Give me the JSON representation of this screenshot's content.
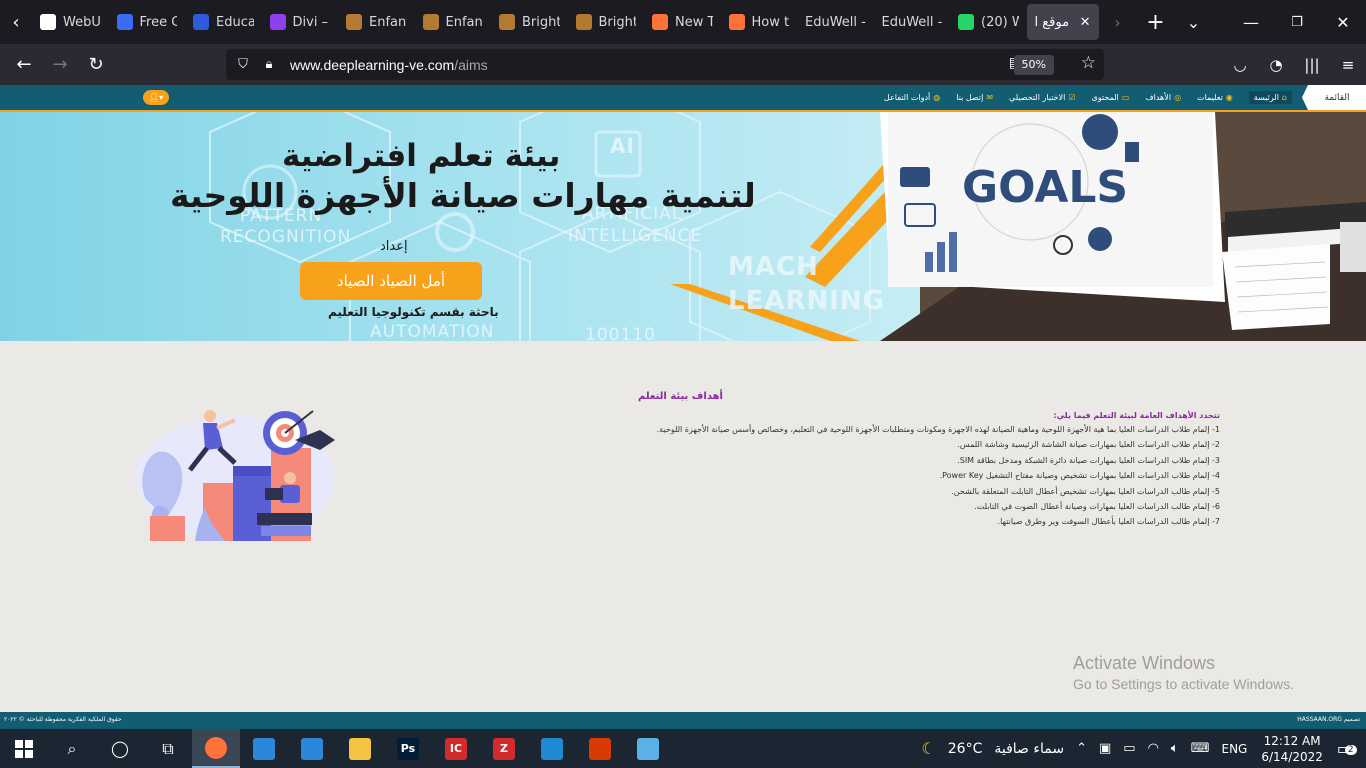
{
  "browser": {
    "tabs": [
      {
        "title": "WebU",
        "icon": "webu-doc-icon",
        "color": "#ffffff"
      },
      {
        "title": "Free C",
        "icon": "n-logo-icon",
        "color": "#3b6cf6"
      },
      {
        "title": "Educa",
        "icon": "gear-logo-icon",
        "color": "#2f5bd8"
      },
      {
        "title": "Divi –",
        "icon": "divi-d-icon",
        "color": "#8f3ff0"
      },
      {
        "title": "Enfant",
        "icon": "bookmark-brown-icon",
        "color": "#b57a32"
      },
      {
        "title": "Enfant",
        "icon": "bookmark-brown-icon",
        "color": "#b57a32"
      },
      {
        "title": "Bright",
        "icon": "bookmark-brown-icon",
        "color": "#b57a32"
      },
      {
        "title": "Bright",
        "icon": "bookmark-brown-icon",
        "color": "#b57a32"
      },
      {
        "title": "New T",
        "icon": "firefox-icon",
        "color": "#ff7139"
      },
      {
        "title": "How t",
        "icon": "firefox-icon",
        "color": "#ff7139"
      },
      {
        "title": "EduWell -",
        "icon": "",
        "color": ""
      },
      {
        "title": "EduWell -",
        "icon": "",
        "color": ""
      },
      {
        "title": "(20) W",
        "icon": "whatsapp-icon",
        "color": "#25d366"
      }
    ],
    "active_tab": {
      "title": "موقع ا",
      "close": "✕"
    },
    "new_tab": "+",
    "url_host": "www.deeplearning-ve.com",
    "url_path": "/aims",
    "zoom": "50%"
  },
  "site": {
    "menu_label": "القائمة",
    "menu": [
      {
        "label": "الرئيسة",
        "icon": "home-icon",
        "glyph": "⌂"
      },
      {
        "label": "تعليمات",
        "icon": "info-icon",
        "glyph": "◉"
      },
      {
        "label": "الأهداف",
        "icon": "target-icon",
        "glyph": "◎"
      },
      {
        "label": "المحتوى",
        "icon": "laptop-icon",
        "glyph": "▭"
      },
      {
        "label": "الاختبار التحصيلي",
        "icon": "check-icon",
        "glyph": "☑"
      },
      {
        "label": "إتصل بنا",
        "icon": "mail-icon",
        "glyph": "✉"
      },
      {
        "label": "أدوات التفاعل",
        "icon": "globe-icon",
        "glyph": "◍"
      }
    ],
    "user_icon": "user-icon"
  },
  "banner": {
    "title_line1": "بيئة تعلم افتراضية",
    "title_line2": "لتنمية مهارات صيانة الأجهزة اللوحية",
    "prepared_by": "إعداد",
    "author": "أمل الصياد الصياد",
    "author_role": "باحثة بقسم تكنولوجيا التعليم",
    "bg_words": [
      "PATTERN",
      "RECOGNITION",
      "ARTIFICIAL",
      "INTELLIGENCE",
      "AUTOMATION",
      "MACH",
      "LEARNING",
      "10011",
      "100110",
      "AI"
    ],
    "goals_word": "GOALS"
  },
  "content": {
    "title": "أهداف بيئة التعلم",
    "intro": "تتحدد الأهداف العامة لبيئة التعلم فيما يلي:",
    "goals": [
      "1- إلمام طلاب الدراسات العليا بما هية الأجهزة اللوحية وماهية الصيانة لهذه الاجهزة ومكونات ومتطلبات الأجهزة اللوحية في التعليم، وخصائص وأسس صيانة الأجهزة اللوحية.",
      "2- إلمام طلاب الدراسات العليا بمهارات صيانة الشاشة الرئيسية وشاشة اللمس.",
      "3- إلمام طلاب الدراسات العليا بمهارات صيانة دائرة الشبكة ومدخل بطاقة SIM.",
      "4- إلمام طلاب الدراسات العليا بمهارات تشخيص وصيانة مفتاح التشغيل Power Key.",
      "5- إلمام طالب الدراسات العليا بمهارات تشخيص أعطال التابلت المتعلقة بالشحن.",
      "6- إلمام طالب الدراسات العليا بمهارات وصيانة أعطال الصوت في التابلت.",
      "7- إلمام طالب الدراسات العليا بأعطال السوفت وير وطرق صيانتها."
    ],
    "activate_title": "Activate Windows",
    "activate_sub": "Go to Settings to activate Windows."
  },
  "footer": {
    "left": "حقوق الملكية الفكرية محفوظة للباحثة © ٢٠٢٢",
    "right": "تصميم HASSAAN.ORG"
  },
  "taskbar": {
    "apps": [
      {
        "name": "firefox",
        "label": "",
        "color": "#ff7139"
      },
      {
        "name": "store",
        "label": "",
        "color": "#2b88d8"
      },
      {
        "name": "mail",
        "label": "",
        "color": "#2b88d8"
      },
      {
        "name": "explorer",
        "label": "",
        "color": "#f5c342"
      },
      {
        "name": "photoshop",
        "label": "Ps",
        "color": "#001e36"
      },
      {
        "name": "ic-app",
        "label": "IC",
        "color": "#d22b2b"
      },
      {
        "name": "pickit",
        "label": "Z",
        "color": "#d22b2b"
      },
      {
        "name": "vscode",
        "label": "",
        "color": "#1f8ad2"
      },
      {
        "name": "office",
        "label": "",
        "color": "#d83b01"
      },
      {
        "name": "paint",
        "label": "",
        "color": "#5bb0e6"
      }
    ],
    "weather": "26°C",
    "weather_text": "سماء صافية",
    "language": "ENG",
    "time": "12:12 AM",
    "date": "6/14/2022",
    "notifications": "2"
  }
}
